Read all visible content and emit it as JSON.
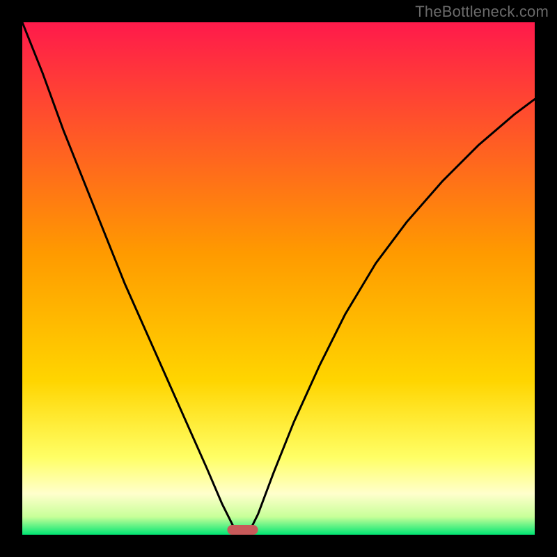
{
  "watermark": "TheBottleneck.com",
  "colors": {
    "frame": "#000000",
    "top": "#ff1a4b",
    "mid": "#ffd500",
    "lowYellow": "#ffff66",
    "cream": "#ffffcc",
    "green": "#00e673",
    "curve": "#000000",
    "marker": "#c85a5a"
  },
  "layout": {
    "outer": 800,
    "inner_left": 32,
    "inner_top": 32,
    "inner_right": 32,
    "inner_bottom": 32
  },
  "chart_data": {
    "type": "line",
    "title": "",
    "xlabel": "",
    "ylabel": "",
    "xlim": [
      0,
      100
    ],
    "ylim": [
      0,
      100
    ],
    "series": [
      {
        "name": "left-curve",
        "x": [
          0,
          4,
          8,
          12,
          16,
          20,
          24,
          28,
          32,
          36,
          39,
          41,
          42
        ],
        "y": [
          100,
          90,
          79,
          69,
          59,
          49,
          40,
          31,
          22,
          13,
          6,
          2,
          0
        ]
      },
      {
        "name": "right-curve",
        "x": [
          44,
          46,
          49,
          53,
          58,
          63,
          69,
          75,
          82,
          89,
          96,
          100
        ],
        "y": [
          0,
          4,
          12,
          22,
          33,
          43,
          53,
          61,
          69,
          76,
          82,
          85
        ]
      }
    ],
    "marker": {
      "x_center": 43,
      "x_halfwidth": 3,
      "y": 0
    },
    "gradient_stops": [
      {
        "pos": 0.0,
        "color": "#ff1a4b"
      },
      {
        "pos": 0.45,
        "color": "#ff9a00"
      },
      {
        "pos": 0.7,
        "color": "#ffd500"
      },
      {
        "pos": 0.85,
        "color": "#ffff66"
      },
      {
        "pos": 0.92,
        "color": "#ffffcc"
      },
      {
        "pos": 0.965,
        "color": "#c8ff99"
      },
      {
        "pos": 1.0,
        "color": "#00e673"
      }
    ]
  }
}
